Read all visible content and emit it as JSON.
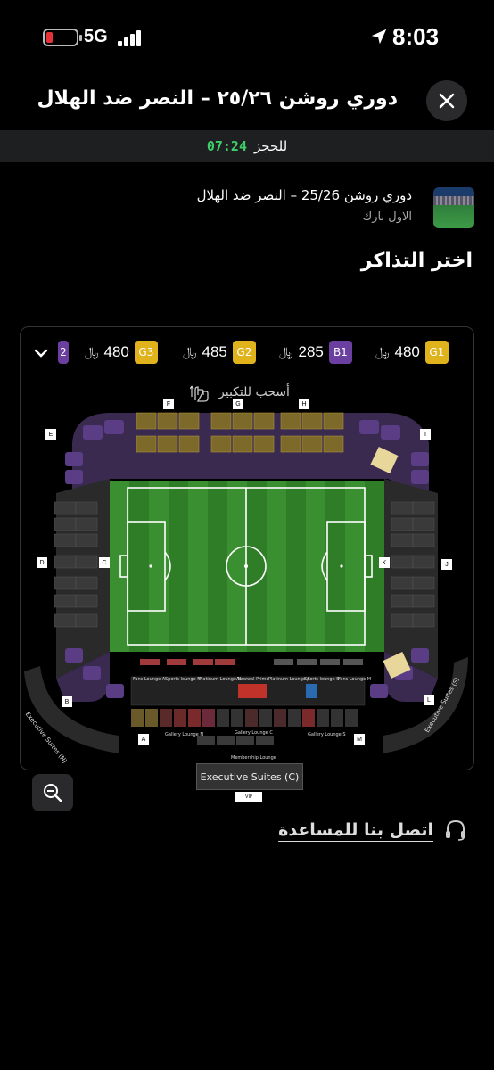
{
  "status": {
    "network": "5G",
    "time": "8:03",
    "battery_level": 0.15
  },
  "header": {
    "title": "دوري روشن ٢٥/٢٦ – النصر ضد الهلال"
  },
  "timer": {
    "value": "07:24",
    "label": "للحجز"
  },
  "event": {
    "title": "دوري روشن 25/26 – النصر ضد الهلال",
    "venue": "الاول بارك"
  },
  "section_title": "اختر التذاكر",
  "categories": [
    {
      "code": "G1",
      "price": "480",
      "color": "#e0b21c"
    },
    {
      "code": "B1",
      "price": "285",
      "color": "#6b3fa0"
    },
    {
      "code": "G2",
      "price": "485",
      "color": "#e0b21c"
    },
    {
      "code": "G3",
      "price": "480",
      "color": "#e0b21c"
    },
    {
      "code": "2",
      "price": "",
      "color": "#6b3fa0"
    }
  ],
  "drag_hint": "أسحب للتكبير",
  "map": {
    "gates": [
      "F",
      "G",
      "H",
      "E",
      "I",
      "D",
      "C",
      "K",
      "J",
      "B",
      "L",
      "A",
      "M"
    ],
    "lounges": [
      "Fans Lounge A",
      "Sports lounge N",
      "Platinum Lounge N",
      "Alawwal Prime",
      "Platinum Lounge S",
      "Sports lounge S",
      "Fans Lounge M",
      "Gallery Lounge N",
      "Gallery Lounge C",
      "Gallery Lounge S",
      "Membership Lounge"
    ],
    "exec_n": "Executive Suites (N)",
    "exec_s": "Executive Suites (S)",
    "exec_c": "Executive Suites (C)",
    "vip": "VIP"
  },
  "help": {
    "label": "اتصل بنا للمساعدة"
  },
  "colors": {
    "accent_green": "#3ecf6a",
    "gold": "#e0b21c",
    "purple": "#6b3fa0"
  }
}
